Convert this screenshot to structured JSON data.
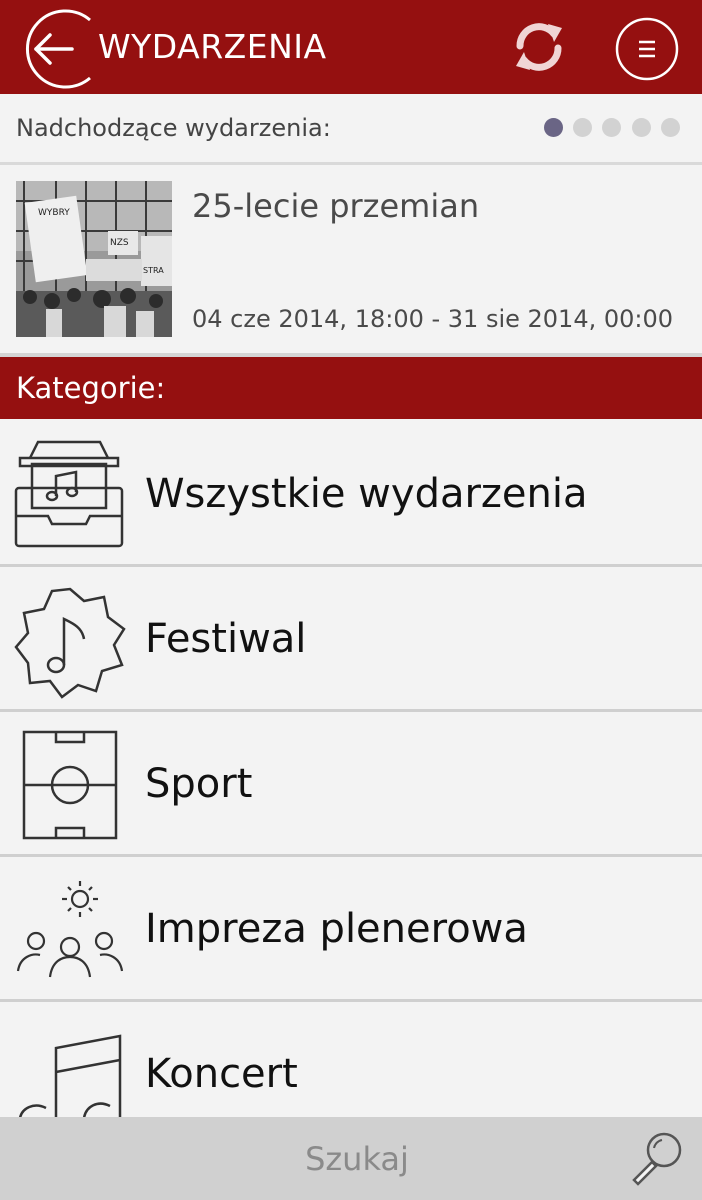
{
  "header": {
    "title": "WYDARZENIA",
    "back_icon": "arrow-left-icon",
    "refresh_icon": "refresh-icon",
    "menu_icon": "menu-icon",
    "color": "#951010"
  },
  "upcoming": {
    "label": "Nadchodzące wydarzenia:",
    "pager_count": 5,
    "pager_active": 0
  },
  "event": {
    "title": "25-lecie przemian",
    "date": "04 cze 2014, 18:00 - 31 sie 2014, 00:00",
    "banner_texts": [
      "WYBRY",
      "NZS",
      "STRA"
    ]
  },
  "categories": {
    "header": "Kategorie:",
    "items": [
      {
        "label": "Wszystkie wydarzenia",
        "icon": "music-inbox-icon"
      },
      {
        "label": "Festiwal",
        "icon": "music-badge-icon"
      },
      {
        "label": "Sport",
        "icon": "football-pitch-icon"
      },
      {
        "label": "Impreza plenerowa",
        "icon": "outdoor-people-icon"
      },
      {
        "label": "Koncert",
        "icon": "music-note-icon"
      }
    ]
  },
  "search": {
    "placeholder": "Szukaj",
    "icon": "search-icon"
  }
}
